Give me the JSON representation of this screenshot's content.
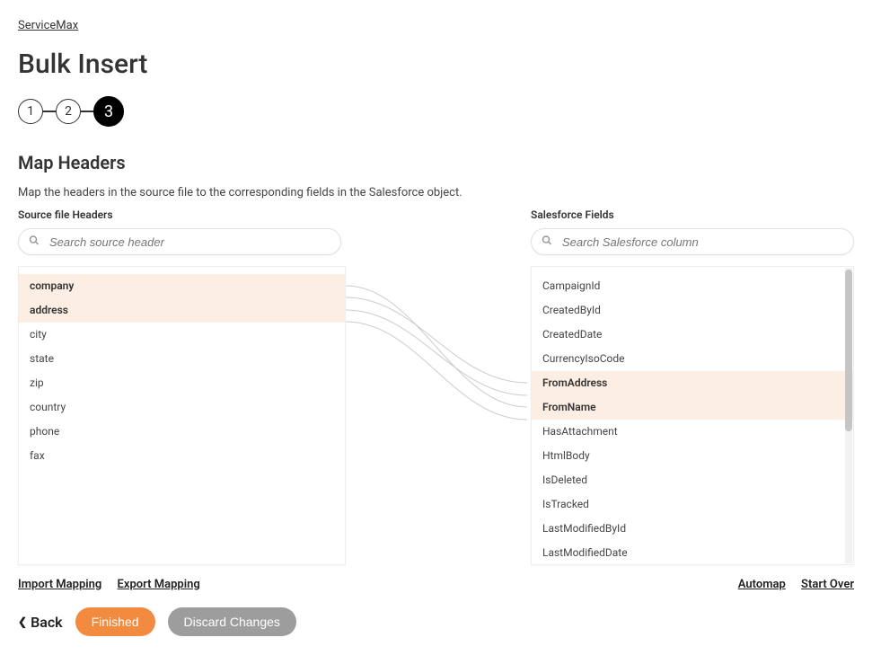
{
  "breadcrumb": "ServiceMax",
  "title": "Bulk Insert",
  "steps": [
    "1",
    "2",
    "3"
  ],
  "active_step_index": 2,
  "section": {
    "title": "Map Headers",
    "desc": "Map the headers in the source file to the corresponding fields in the Salesforce object."
  },
  "left": {
    "label": "Source file Headers",
    "search_placeholder": "Search source header",
    "items": [
      {
        "label": "company",
        "mapped": true
      },
      {
        "label": "address",
        "mapped": true
      },
      {
        "label": "city",
        "mapped": false
      },
      {
        "label": "state",
        "mapped": false
      },
      {
        "label": "zip",
        "mapped": false
      },
      {
        "label": "country",
        "mapped": false
      },
      {
        "label": "phone",
        "mapped": false
      },
      {
        "label": "fax",
        "mapped": false
      }
    ]
  },
  "right": {
    "label": "Salesforce Fields",
    "search_placeholder": "Search Salesforce column",
    "items": [
      {
        "label": "CampaignId",
        "mapped": false
      },
      {
        "label": "CreatedById",
        "mapped": false
      },
      {
        "label": "CreatedDate",
        "mapped": false
      },
      {
        "label": "CurrencyIsoCode",
        "mapped": false
      },
      {
        "label": "FromAddress",
        "mapped": true
      },
      {
        "label": "FromName",
        "mapped": true
      },
      {
        "label": "HasAttachment",
        "mapped": false
      },
      {
        "label": "HtmlBody",
        "mapped": false
      },
      {
        "label": "IsDeleted",
        "mapped": false
      },
      {
        "label": "IsTracked",
        "mapped": false
      },
      {
        "label": "LastModifiedById",
        "mapped": false
      },
      {
        "label": "LastModifiedDate",
        "mapped": false
      }
    ]
  },
  "links": {
    "import": "Import Mapping",
    "export": "Export Mapping",
    "automap": "Automap",
    "startover": "Start Over"
  },
  "footer": {
    "back": "Back",
    "finished": "Finished",
    "discard": "Discard Changes"
  }
}
